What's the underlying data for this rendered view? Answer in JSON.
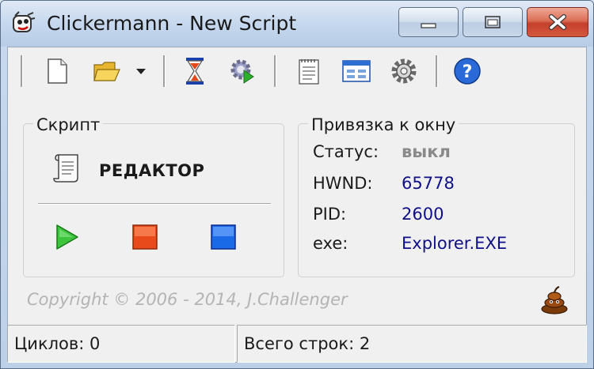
{
  "window": {
    "title": "Clickermann - New Script"
  },
  "toolbar": {
    "buttons": [
      "new-file",
      "open-folder",
      "open-dropdown",
      "hourglass",
      "gear-play",
      "notepad",
      "window",
      "settings",
      "help"
    ]
  },
  "script_group": {
    "title": "Скрипт",
    "editor_label": "РЕДАКТОР"
  },
  "binding_group": {
    "title": "Привязка к окну",
    "rows": [
      {
        "key": "Статус:",
        "value": "выкл"
      },
      {
        "key": "HWND:",
        "value": "65778"
      },
      {
        "key": "PID:",
        "value": "2600"
      },
      {
        "key": "exe:",
        "value": "Explorer.EXE"
      }
    ]
  },
  "copyright": "Copyright © 2006 - 2014, J.Challenger",
  "statusbar": {
    "cycles": "Циклов: 0",
    "lines": "Всего строк: 2"
  },
  "colors": {
    "accent_blue": "#101088",
    "status_off": "#8a8a8a"
  }
}
